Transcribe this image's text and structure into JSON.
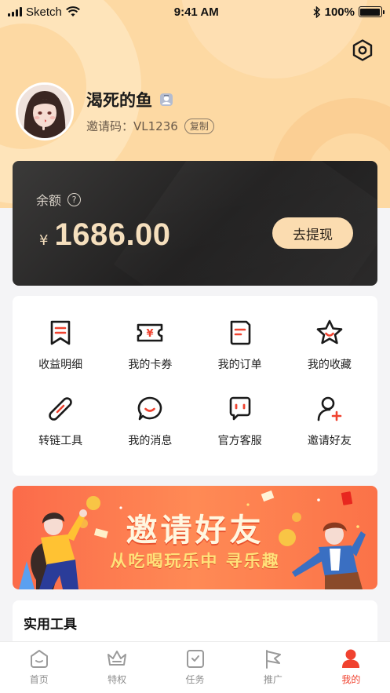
{
  "status_bar": {
    "carrier": "Sketch",
    "time": "9:41 AM",
    "battery": "100%"
  },
  "profile": {
    "nickname": "渴死的鱼",
    "invite_label": "邀请码：",
    "invite_code": "VL1236",
    "copy_label": "复制"
  },
  "balance": {
    "label": "余额",
    "help_icon": "?",
    "currency": "¥",
    "amount": "1686.00",
    "withdraw_label": "去提现"
  },
  "menu": [
    {
      "label": "收益明细",
      "icon": "bookmark-list-icon"
    },
    {
      "label": "我的卡券",
      "icon": "ticket-icon"
    },
    {
      "label": "我的订单",
      "icon": "order-doc-icon"
    },
    {
      "label": "我的收藏",
      "icon": "star-icon"
    },
    {
      "label": "转链工具",
      "icon": "link-icon"
    },
    {
      "label": "我的消息",
      "icon": "chat-bubble-icon"
    },
    {
      "label": "官方客服",
      "icon": "service-icon"
    },
    {
      "label": "邀请好友",
      "icon": "add-user-icon"
    }
  ],
  "banner": {
    "title": "邀请好友",
    "subtitle": "从吃喝玩乐中 寻乐趣"
  },
  "tools": {
    "title": "实用工具"
  },
  "tabs": [
    {
      "label": "首页",
      "icon": "home-icon"
    },
    {
      "label": "特权",
      "icon": "crown-icon"
    },
    {
      "label": "任务",
      "icon": "task-icon"
    },
    {
      "label": "推广",
      "icon": "flag-icon"
    },
    {
      "label": "我的",
      "icon": "user-icon",
      "active": true
    }
  ],
  "colors": {
    "accent": "#f0422f",
    "header_bg": "#fdd9a3",
    "gold_text": "#f5dfbd"
  }
}
